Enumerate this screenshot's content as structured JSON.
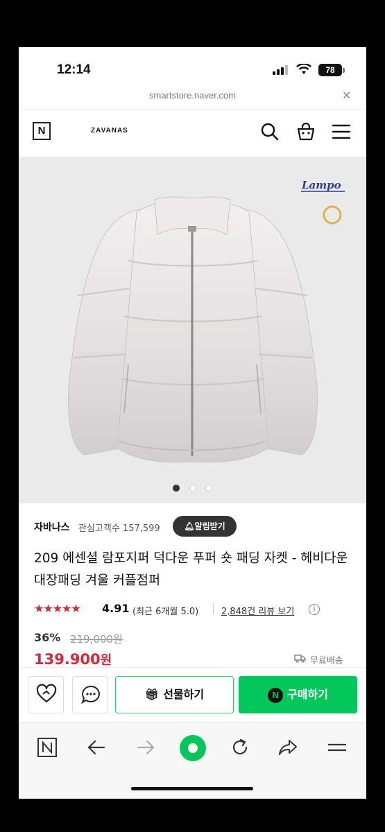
{
  "status": {
    "time": "12:14",
    "battery": "78"
  },
  "browser": {
    "url": "smartstore.naver.com"
  },
  "header": {
    "logo": "N",
    "store_name": "ZAVANAS",
    "icons": [
      "search-icon",
      "cart-icon",
      "menu-icon"
    ]
  },
  "gallery": {
    "total": 3,
    "active": 1
  },
  "store": {
    "name": "자바나스",
    "followers_label": "관심고객수 157,599",
    "alarm_label": "알림받기"
  },
  "product": {
    "title": "209 에센셜 람포지퍼 덕다운 푸퍼 숏 패딩 자켓 - 헤비다운 대장패딩 겨울 커플점퍼",
    "stars": "★★★★★",
    "rating": "4.91",
    "recent_rating": "(최근 6개월 5.0)",
    "reviews_link": "2,848건 리뷰 보기",
    "discount": "36%",
    "original_price": "219,000원",
    "price": "139.900",
    "price_unit": "원",
    "shipping": "무료배송"
  },
  "actions": {
    "gift_label": "선물하기",
    "buy_label": "구매하기",
    "buy_badge": "N"
  },
  "colors": {
    "naver_green": "#03c75a",
    "price_red": "#d8273a"
  }
}
